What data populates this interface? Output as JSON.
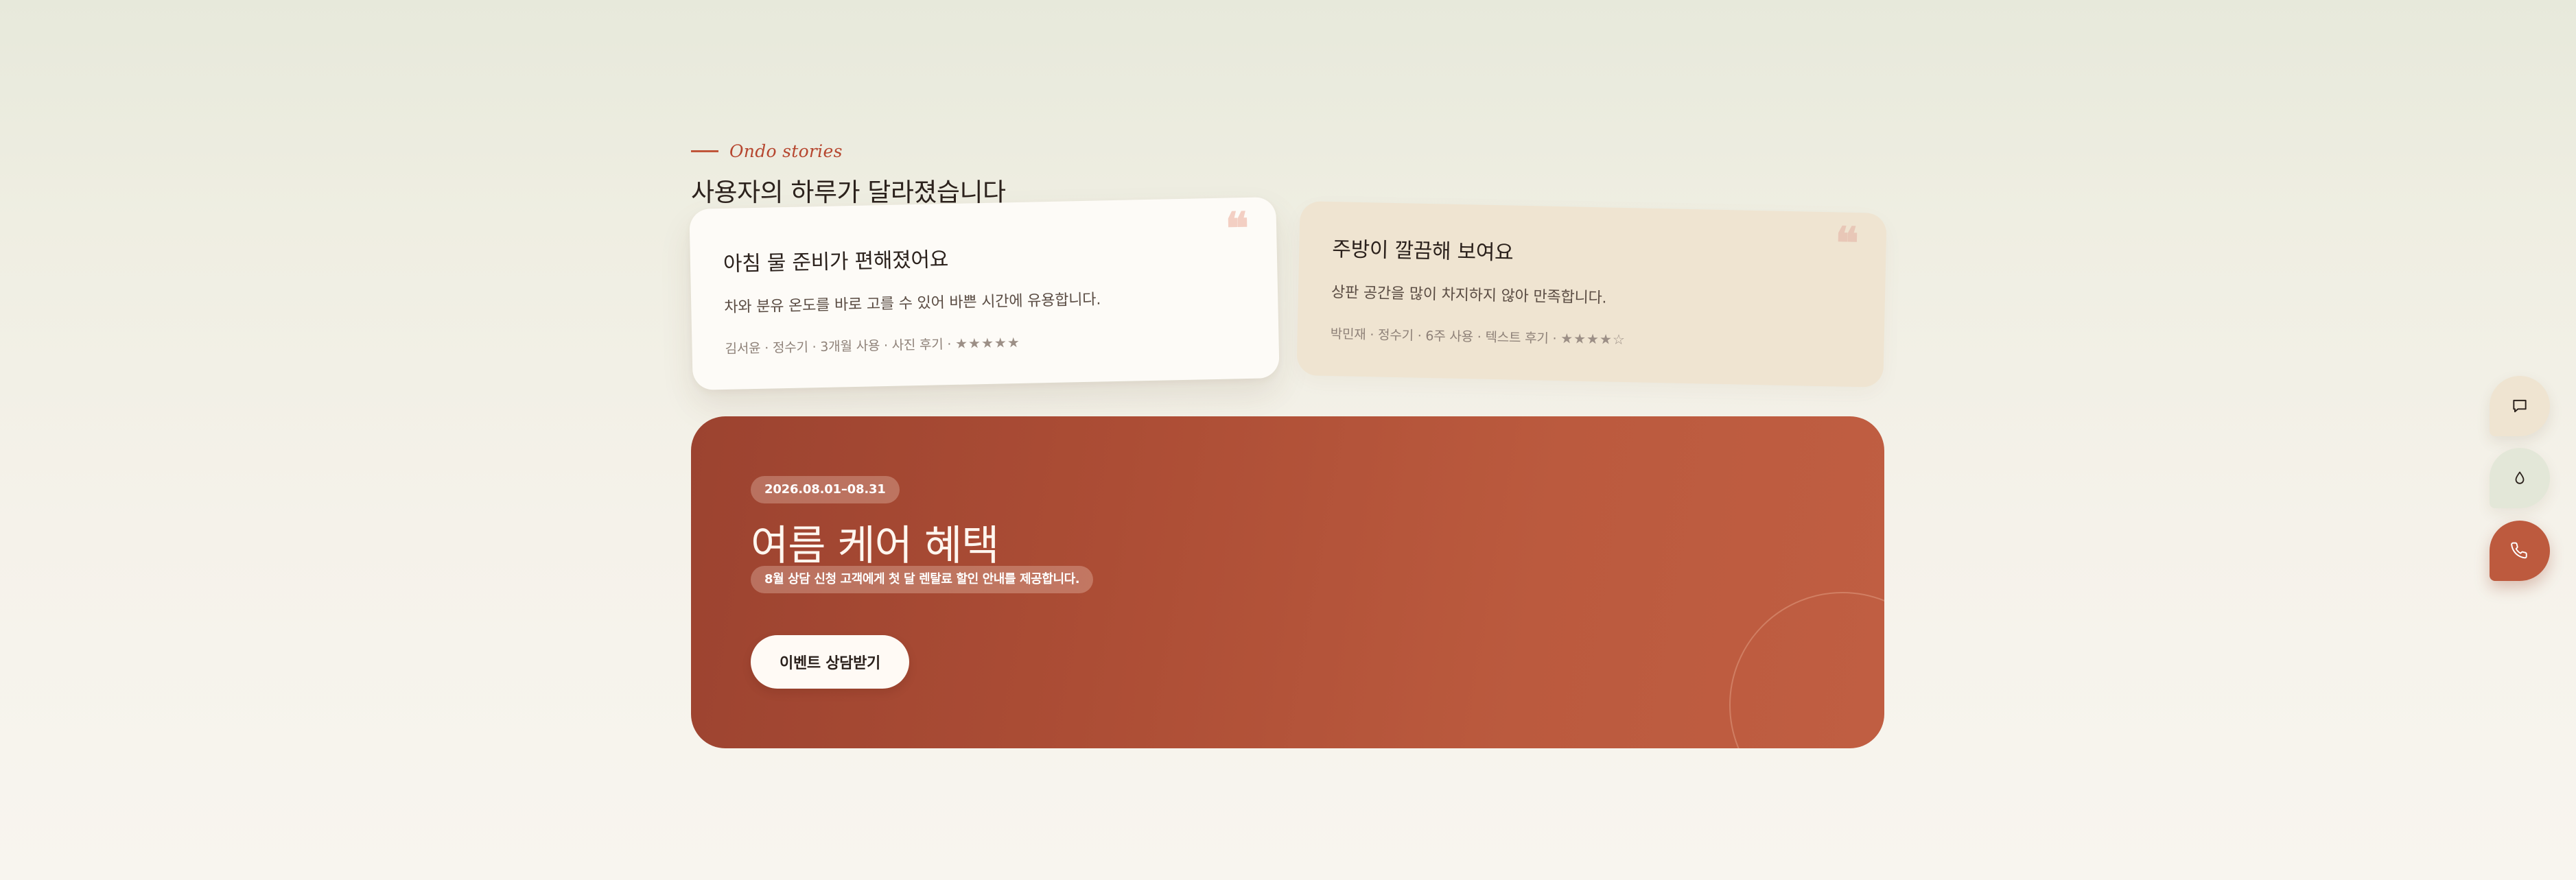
{
  "stories": {
    "eyebrow": "Ondo stories",
    "title": "사용자의 하루가 달라졌습니다",
    "quote_glyph": "❝",
    "reviews": [
      {
        "title": "아침 물 준비가 편해졌어요",
        "body": "차와 분유 온도를 바로 고를 수 있어 바쁜 시간에 유용합니다.",
        "meta": "김서윤 · 정수기 · 3개월 사용 · 사진 후기 · ",
        "stars": "★★★★★",
        "rating": 5
      },
      {
        "title": "주방이 깔끔해 보여요",
        "body": "상판 공간을 많이 차지하지 않아 만족합니다.",
        "meta": "박민재 · 정수기 · 6주 사용 · 텍스트 후기 · ",
        "stars": "★★★★☆",
        "rating": 4
      }
    ]
  },
  "promo": {
    "date_range": "2026.08.01–08.31",
    "title": "여름 케어 혜택",
    "description": "8월 상담 신청 고객에게 첫 달 렌탈료 할인 안내를 제공합니다.",
    "cta_label": "이벤트 상담받기"
  },
  "floating_actions": {
    "items": [
      {
        "icon": "chat-icon"
      },
      {
        "icon": "water-drop-icon"
      },
      {
        "icon": "phone-icon"
      }
    ],
    "colors": {
      "chat_bg": "#efe4d1",
      "drop_bg": "#e3e7d8",
      "call_bg": "#bd5a3e"
    }
  },
  "theme": {
    "accent": "#c0563b",
    "promo_gradient_start": "#9c4330",
    "promo_gradient_end": "#c05e42"
  }
}
